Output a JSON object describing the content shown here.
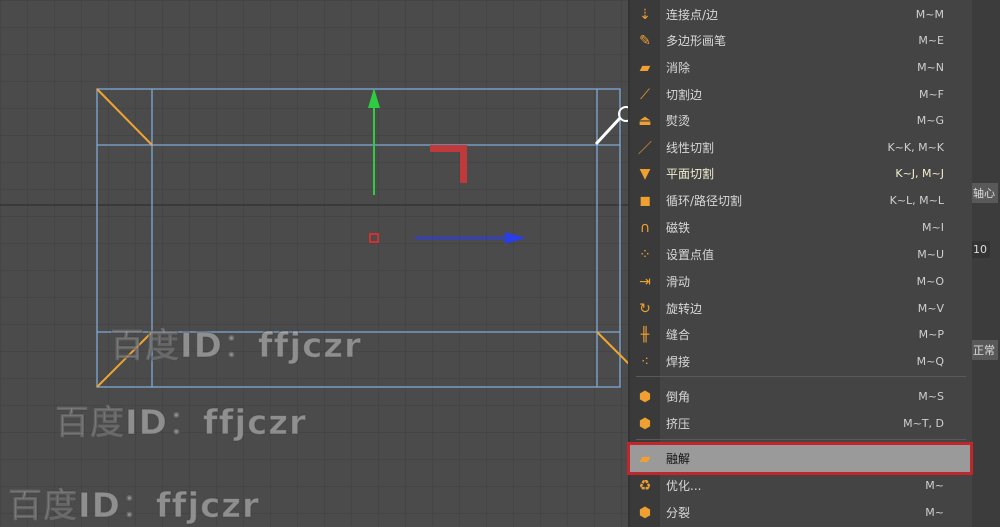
{
  "menu": {
    "items": [
      {
        "label": "连接点/边",
        "shortcut": "M~M",
        "icon": "connect-points-edges-icon",
        "glyph": "⇣"
      },
      {
        "label": "多边形画笔",
        "shortcut": "M~E",
        "icon": "polygon-pen-icon",
        "glyph": "✎"
      },
      {
        "label": "消除",
        "shortcut": "M~N",
        "icon": "dissolve-icon",
        "glyph": "▰"
      },
      {
        "label": "切割边",
        "shortcut": "M~F",
        "icon": "cut-edges-icon",
        "glyph": "⟋"
      },
      {
        "label": "熨烫",
        "shortcut": "M~G",
        "icon": "iron-icon",
        "glyph": "⏏"
      },
      {
        "label": "线性切割",
        "shortcut": "K~K, M~K",
        "icon": "line-cut-icon",
        "glyph": "／"
      },
      {
        "label": "平面切割",
        "shortcut": "K~J, M~J",
        "icon": "plane-cut-icon",
        "glyph": "▼"
      },
      {
        "label": "循环/路径切割",
        "shortcut": "K~L, M~L",
        "icon": "loop-path-cut-icon",
        "glyph": "◼"
      },
      {
        "label": "磁铁",
        "shortcut": "M~I",
        "icon": "magnet-icon",
        "glyph": "∩"
      },
      {
        "label": "设置点值",
        "shortcut": "M~U",
        "icon": "set-point-value-icon",
        "glyph": "⁘"
      },
      {
        "label": "滑动",
        "shortcut": "M~O",
        "icon": "slide-icon",
        "glyph": "⇥"
      },
      {
        "label": "旋转边",
        "shortcut": "M~V",
        "icon": "spin-edge-icon",
        "glyph": "↻"
      },
      {
        "label": "缝合",
        "shortcut": "M~P",
        "icon": "stitch-icon",
        "glyph": "╫"
      },
      {
        "label": "焊接",
        "shortcut": "M~Q",
        "icon": "weld-icon",
        "glyph": "⁖"
      },
      {
        "label": "倒角",
        "shortcut": "M~S",
        "icon": "bevel-icon",
        "glyph": "⬢"
      },
      {
        "label": "挤压",
        "shortcut": "M~T, D",
        "icon": "extrude-icon",
        "glyph": "⬢"
      },
      {
        "label": "融解",
        "shortcut": "",
        "icon": "melt-icon",
        "glyph": "▰"
      },
      {
        "label": "优化...",
        "shortcut": "M~",
        "icon": "optimize-icon",
        "glyph": "♻"
      },
      {
        "label": "分裂",
        "shortcut": "M~",
        "icon": "split-icon",
        "glyph": "⬢"
      }
    ],
    "highlighted_index": 16
  },
  "right_panel": {
    "labels": [
      "轴心",
      "10",
      "正常"
    ]
  },
  "watermark": "百度ID：ffjczr"
}
